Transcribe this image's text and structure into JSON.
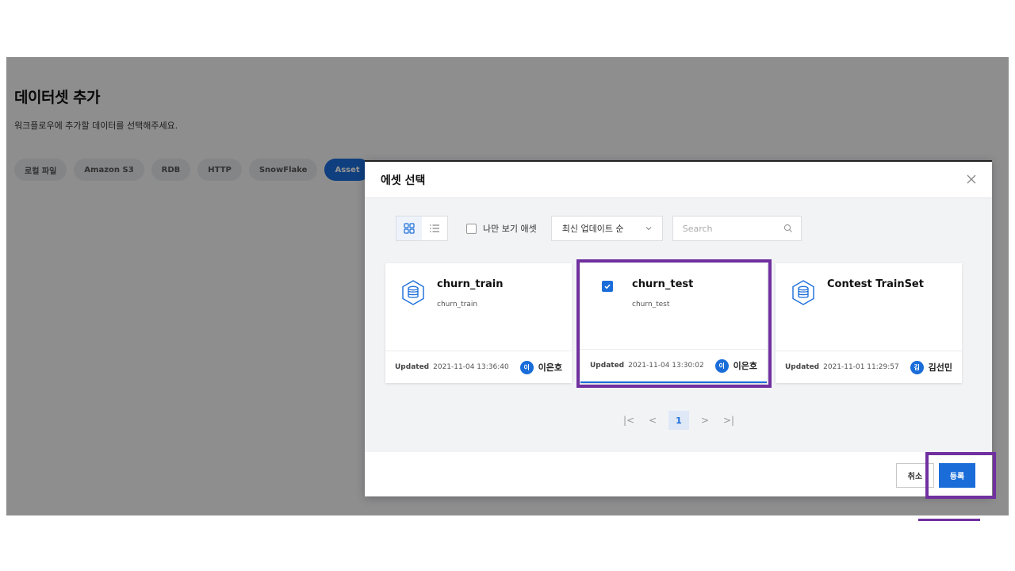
{
  "background": {
    "title": "데이터셋 추가",
    "subtitle": "워크플로우에 추가할 데이터를 선택해주세요.",
    "chips": [
      "로컬 파일",
      "Amazon S3",
      "RDB",
      "HTTP",
      "SnowFlake",
      "Asset"
    ],
    "active_chip": "Asset"
  },
  "modal": {
    "title": "에셋 선택",
    "close_icon": "close-icon",
    "toolbar": {
      "grid_view_icon": "grid-view-icon",
      "list_view_icon": "list-view-icon",
      "mine_only_label": "나만 보기 애셋",
      "mine_only_checked": false,
      "sort_value": "최신 업데이트 순",
      "search_placeholder": "Search"
    },
    "cards": [
      {
        "name": "churn_train",
        "description": "churn_train",
        "updated_label": "Updated",
        "updated_at": "2021-11-04 13:36:40",
        "owner_initial": "이",
        "owner": "이은호",
        "selected": false
      },
      {
        "name": "churn_test",
        "description": "churn_test",
        "updated_label": "Updated",
        "updated_at": "2021-11-04 13:30:02",
        "owner_initial": "이",
        "owner": "이은호",
        "selected": true
      },
      {
        "name": "Contest TrainSet",
        "description": "",
        "updated_label": "Updated",
        "updated_at": "2021-11-01 11:29:57",
        "owner_initial": "김",
        "owner": "김선민",
        "selected": false
      }
    ],
    "pagination": {
      "first": "|<",
      "prev": "<",
      "current_page": "1",
      "next": ">",
      "last": ">|"
    },
    "footer": {
      "cancel_label": "취소",
      "submit_label": "등록"
    }
  },
  "colors": {
    "accent": "#1a6dd9",
    "highlight": "#7030a0"
  }
}
